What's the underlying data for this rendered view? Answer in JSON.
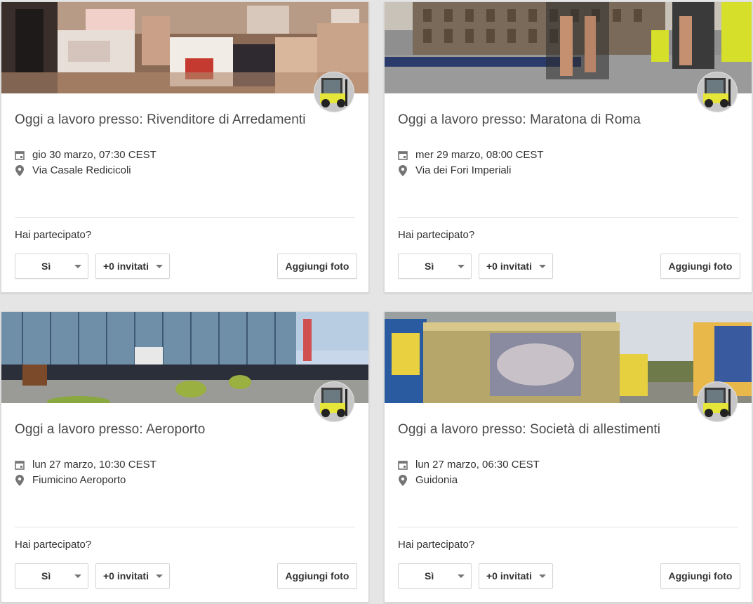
{
  "cards": [
    {
      "title": "Oggi a lavoro presso: Rivenditore di Arredamenti",
      "date": "gio 30 marzo, 07:30 CEST",
      "location": "Via Casale Redicicoli",
      "question": "Hai partecipato?",
      "rsvp": "Sì",
      "guests": "+0 invitati",
      "add_photo": "Aggiungi foto"
    },
    {
      "title": "Oggi a lavoro presso: Maratona di Roma",
      "date": "mer 29 marzo, 08:00 CEST",
      "location": "Via dei Fori Imperiali",
      "question": "Hai partecipato?",
      "rsvp": "Sì",
      "guests": "+0 invitati",
      "add_photo": "Aggiungi foto"
    },
    {
      "title": "Oggi a lavoro presso: Aeroporto",
      "date": "lun 27 marzo, 10:30 CEST",
      "location": "Fiumicino Aeroporto",
      "question": "Hai partecipato?",
      "rsvp": "Sì",
      "guests": "+0 invitati",
      "add_photo": "Aggiungi foto"
    },
    {
      "title": "Oggi a lavoro presso: Società di allestimenti",
      "date": "lun 27 marzo, 06:30 CEST",
      "location": "Guidonia",
      "question": "Hai partecipato?",
      "rsvp": "Sì",
      "guests": "+0 invitati",
      "add_photo": "Aggiungi foto"
    }
  ],
  "icons": {
    "date": "calendar-icon",
    "location": "location-pin-icon",
    "dropdown": "chevron-down-icon",
    "avatar": "forklift-avatar"
  },
  "colors": {
    "page_bg": "#e5e5e5",
    "card_bg": "#ffffff",
    "title_text": "#4a4a4a",
    "icon": "#757575"
  }
}
